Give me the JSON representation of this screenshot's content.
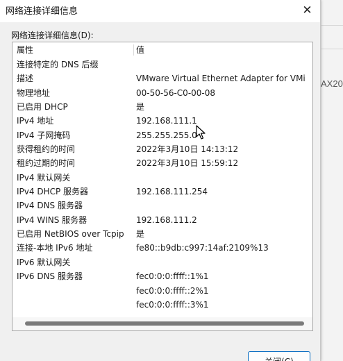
{
  "dialog": {
    "title": "网络连接详细信息",
    "group_label": "网络连接详细信息(D):",
    "close_button_label": "关闭(C)"
  },
  "list": {
    "col_property": "属性",
    "col_value": "值",
    "rows": [
      {
        "property": "连接特定的 DNS 后缀",
        "value": ""
      },
      {
        "property": "描述",
        "value": "VMware Virtual Ethernet Adapter for VMi"
      },
      {
        "property": "物理地址",
        "value": "00-50-56-C0-00-08"
      },
      {
        "property": "已启用 DHCP",
        "value": "是"
      },
      {
        "property": "IPv4 地址",
        "value": "192.168.111.1"
      },
      {
        "property": "IPv4 子网掩码",
        "value": "255.255.255.0"
      },
      {
        "property": "获得租约的时间",
        "value": "2022年3月10日 14:13:12"
      },
      {
        "property": "租约过期的时间",
        "value": "2022年3月10日 15:59:12"
      },
      {
        "property": "IPv4 默认网关",
        "value": ""
      },
      {
        "property": "IPv4 DHCP 服务器",
        "value": "192.168.111.254"
      },
      {
        "property": "IPv4 DNS 服务器",
        "value": ""
      },
      {
        "property": "IPv4 WINS 服务器",
        "value": "192.168.111.2"
      },
      {
        "property": "已启用 NetBIOS over Tcpip",
        "value": "是"
      },
      {
        "property": "连接-本地 IPv6 地址",
        "value": "fe80::b9db:c997:14af:2109%13"
      },
      {
        "property": "IPv6 默认网关",
        "value": ""
      },
      {
        "property": "IPv6 DNS 服务器",
        "value": "fec0:0:0:ffff::1%1"
      },
      {
        "property": "",
        "value": "fec0:0:0:ffff::2%1"
      },
      {
        "property": "",
        "value": "fec0:0:0:ffff::3%1"
      }
    ]
  },
  "background": {
    "partial_text": "AX20"
  }
}
